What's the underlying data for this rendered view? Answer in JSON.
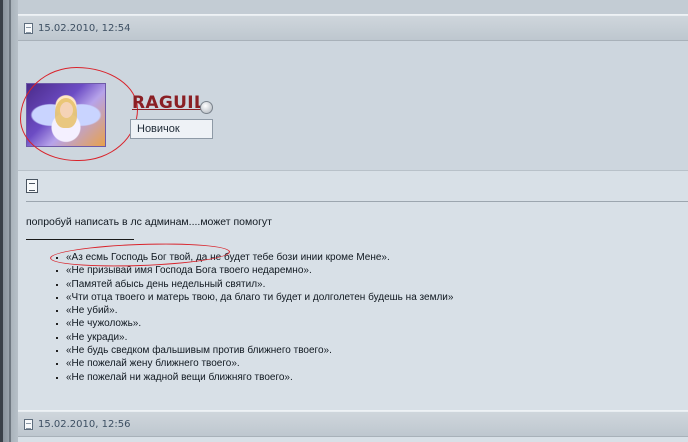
{
  "posts": [
    {
      "date": "15.02.2010, 12:54",
      "author": {
        "username": "RAGUIL",
        "rank": "Новичок"
      },
      "message": "попробуй написать в лс админам....может помогут",
      "commandments": [
        "«Аз есмь Господь Бог твой, да не будет тебе бози инии кроме Мене».",
        "«Не призывай имя Господа Бога твоего недаремно».",
        "«Памятей абысь день недельный святил».",
        "«Чти отца твоего и матерь твою, да благо ти будет и долголетен будешь на земли»",
        "«Не убий».",
        "«Не чужоложь».",
        "«Не укради».",
        "«Не будь сведком фальшивым против ближнего твоего».",
        "«Не пожелай жену ближнего твоего».",
        "«Не пожелай ни жадной вещи ближняго твоего»."
      ]
    },
    {
      "date": "15.02.2010, 12:56"
    }
  ],
  "colors": {
    "background": "#c3ccd4",
    "username": "#8a1f24",
    "annotation_circle": "#d9232b"
  },
  "icons": {
    "post_header": "document-icon",
    "status": "status-dot-icon",
    "post_body": "note-icon"
  }
}
